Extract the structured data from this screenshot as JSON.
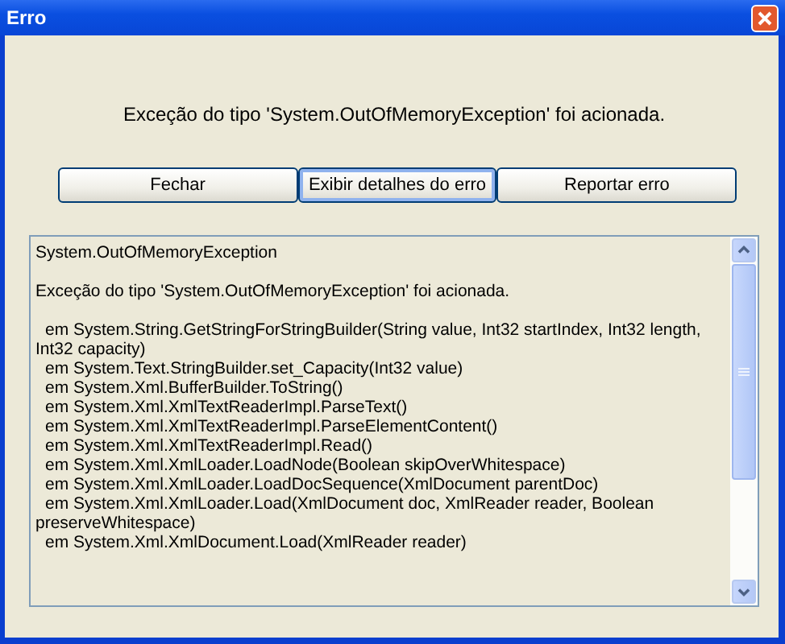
{
  "window": {
    "title": "Erro"
  },
  "message": "Exceção do tipo 'System.OutOfMemoryException' foi acionada.",
  "buttons": [
    {
      "label": "Fechar",
      "focused": false
    },
    {
      "label": "Exibir detalhes do erro",
      "focused": true
    },
    {
      "label": "Reportar erro",
      "focused": false
    }
  ],
  "details": [
    {
      "kind": "message",
      "text": "System.OutOfMemoryException"
    },
    {
      "kind": "message",
      "text": "Exceção do tipo 'System.OutOfMemoryException' foi acionada."
    },
    {
      "kind": "frame",
      "text": "em System.String.GetStringForStringBuilder(String value, Int32 startIndex, Int32 length, Int32 capacity)"
    },
    {
      "kind": "frame",
      "text": "em System.Text.StringBuilder.set_Capacity(Int32 value)"
    },
    {
      "kind": "frame",
      "text": "em System.Xml.BufferBuilder.ToString()"
    },
    {
      "kind": "frame",
      "text": "em System.Xml.XmlTextReaderImpl.ParseText()"
    },
    {
      "kind": "frame",
      "text": "em System.Xml.XmlTextReaderImpl.ParseElementContent()"
    },
    {
      "kind": "frame",
      "text": "em System.Xml.XmlTextReaderImpl.Read()"
    },
    {
      "kind": "frame",
      "text": "em System.Xml.XmlLoader.LoadNode(Boolean skipOverWhitespace)"
    },
    {
      "kind": "frame",
      "text": "em System.Xml.XmlLoader.LoadDocSequence(XmlDocument parentDoc)"
    },
    {
      "kind": "frame",
      "text": "em System.Xml.XmlLoader.Load(XmlDocument doc, XmlReader reader, Boolean preserveWhitespace)"
    },
    {
      "kind": "frame",
      "text": "em System.Xml.XmlDocument.Load(XmlReader reader)"
    }
  ]
}
